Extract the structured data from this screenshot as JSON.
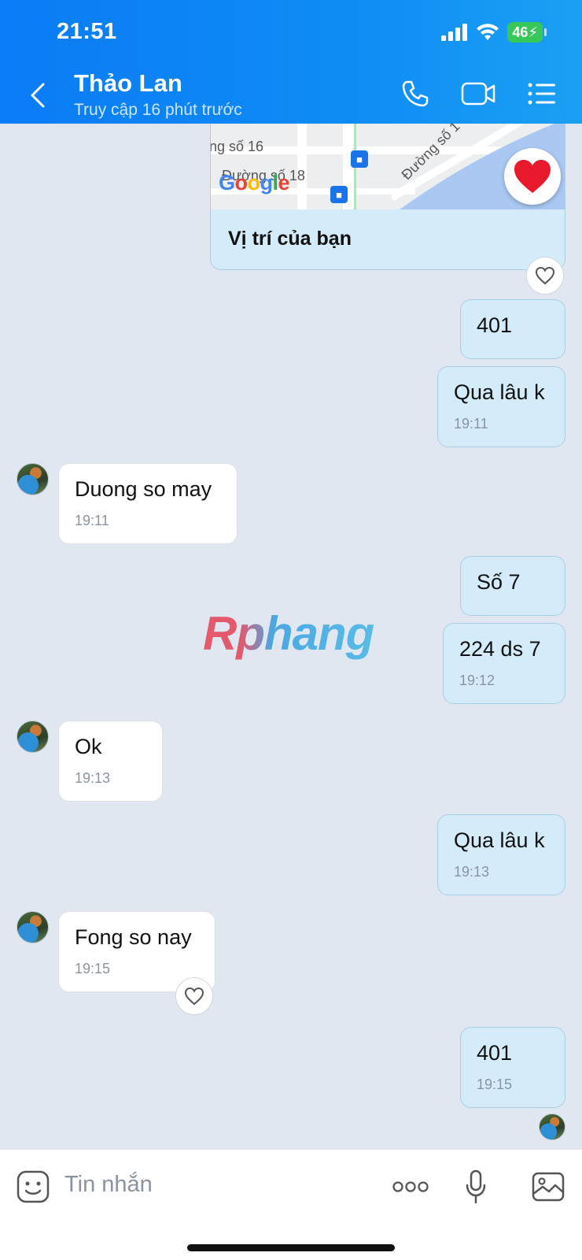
{
  "status_bar": {
    "time": "21:51",
    "battery": "46"
  },
  "header": {
    "name": "Thảo Lan",
    "status": "Truy cập 16 phút trước"
  },
  "map": {
    "labels": [
      "ng số 16",
      "Đường số 18",
      "Đường số 1"
    ],
    "brand": "Google",
    "caption": "Vị trí của bạn"
  },
  "messages": [
    {
      "side": "sent",
      "text": "401",
      "time": ""
    },
    {
      "side": "sent",
      "text": "Qua lâu k",
      "time": "19:11"
    },
    {
      "side": "recv",
      "text": "Duong so may",
      "time": "19:11"
    },
    {
      "side": "sent",
      "text": "Số 7",
      "time": ""
    },
    {
      "side": "sent",
      "text": "224 ds 7",
      "time": "19:12"
    },
    {
      "side": "recv",
      "text": "Ok",
      "time": "19:13"
    },
    {
      "side": "sent",
      "text": "Qua lâu k",
      "time": "19:13"
    },
    {
      "side": "recv",
      "text": "Fong so nay",
      "time": "19:15"
    },
    {
      "side": "sent",
      "text": "401",
      "time": "19:15"
    }
  ],
  "watermark": "Rphang",
  "input": {
    "placeholder": "Tin nhắn"
  },
  "colors": {
    "header": "#0a7cf7",
    "sent_bubble": "#d4ecfa",
    "recv_bubble": "#ffffff",
    "background": "#e1e7f0",
    "heart": "#e8192c"
  }
}
